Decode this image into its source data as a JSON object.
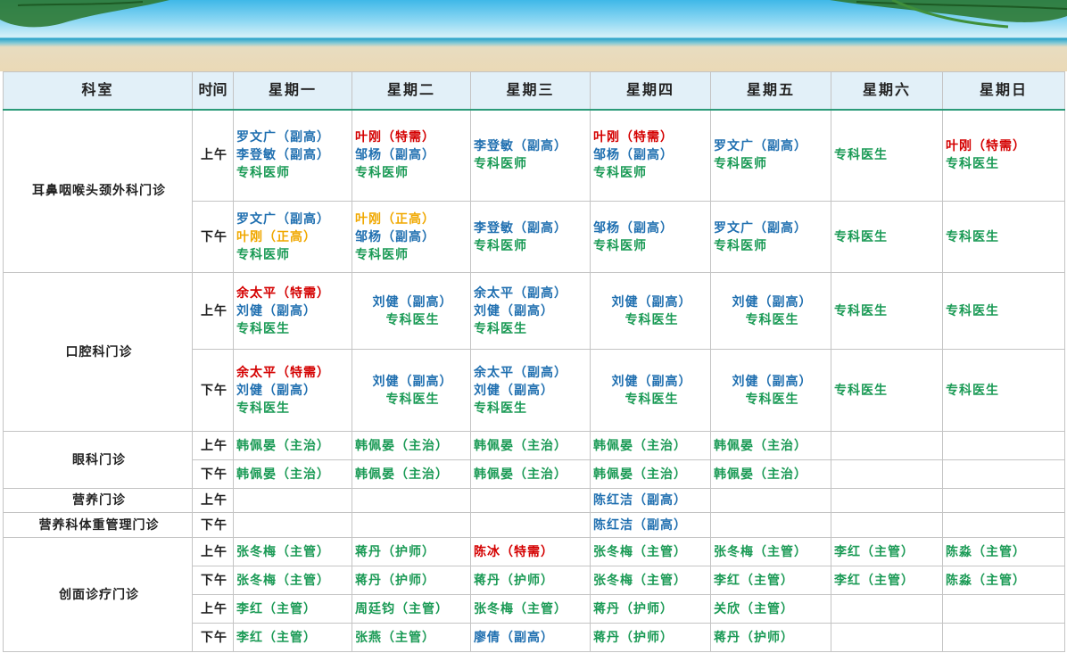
{
  "colors": {
    "blue": "#1f6fb0",
    "green": "#1a9a55",
    "red": "#d40000",
    "orange": "#f0a800"
  },
  "headers": [
    "科室",
    "时间",
    "星期一",
    "星期二",
    "星期三",
    "星期四",
    "星期五",
    "星期六",
    "星期日"
  ],
  "departments": {
    "ent": "耳鼻咽喉头颈外科门诊",
    "oral": "口腔科门诊",
    "eye": "眼科门诊",
    "nutrition": "营养门诊",
    "weight": "营养科体重管理门诊",
    "wound": "创面诊疗门诊"
  },
  "slots": {
    "am": "上午",
    "pm": "下午"
  },
  "rows": [
    {
      "slot": "上午",
      "cells": [
        [
          {
            "t": "罗文广（副高）",
            "c": "blue"
          },
          {
            "t": "李登敏（副高）",
            "c": "blue"
          },
          {
            "t": "专科医师",
            "c": "green"
          }
        ],
        [
          {
            "t": "叶刚（特需）",
            "c": "red"
          },
          {
            "t": "邹杨（副高）",
            "c": "blue"
          },
          {
            "t": "专科医师",
            "c": "green"
          }
        ],
        [
          {
            "t": "李登敏（副高）",
            "c": "blue"
          },
          {
            "t": "专科医师",
            "c": "green"
          }
        ],
        [
          {
            "t": "叶刚（特需）",
            "c": "red"
          },
          {
            "t": "邹杨（副高）",
            "c": "blue"
          },
          {
            "t": "专科医师",
            "c": "green"
          }
        ],
        [
          {
            "t": "罗文广（副高）",
            "c": "blue"
          },
          {
            "t": "专科医师",
            "c": "green"
          }
        ],
        [
          {
            "t": "专科医生",
            "c": "green"
          }
        ],
        [
          {
            "t": "叶刚（特需）",
            "c": "red"
          },
          {
            "t": "专科医生",
            "c": "green"
          }
        ]
      ]
    },
    {
      "slot": "下午",
      "cells": [
        [
          {
            "t": "罗文广（副高）",
            "c": "blue"
          },
          {
            "t": "叶刚（正高）",
            "c": "orange"
          },
          {
            "t": "专科医师",
            "c": "green"
          }
        ],
        [
          {
            "t": "叶刚（正高）",
            "c": "orange"
          },
          {
            "t": "邹杨（副高）",
            "c": "blue"
          },
          {
            "t": "专科医师",
            "c": "green"
          }
        ],
        [
          {
            "t": "李登敏（副高）",
            "c": "blue"
          },
          {
            "t": "专科医师",
            "c": "green"
          }
        ],
        [
          {
            "t": "邹杨（副高）",
            "c": "blue"
          },
          {
            "t": "专科医师",
            "c": "green"
          }
        ],
        [
          {
            "t": "罗文广（副高）",
            "c": "blue"
          },
          {
            "t": "专科医师",
            "c": "green"
          }
        ],
        [
          {
            "t": "专科医生",
            "c": "green"
          }
        ],
        [
          {
            "t": "专科医生",
            "c": "green"
          }
        ]
      ]
    },
    {
      "slot": "上午",
      "cells": [
        [
          {
            "t": "余太平（特需）",
            "c": "red"
          },
          {
            "t": "刘健（副高）",
            "c": "blue"
          },
          {
            "t": "专科医生",
            "c": "green"
          }
        ],
        [
          {
            "t": "刘健（副高）",
            "c": "blue"
          },
          {
            "t": "专科医生",
            "c": "green"
          }
        ],
        [
          {
            "t": "余太平（副高）",
            "c": "blue"
          },
          {
            "t": "刘健（副高）",
            "c": "blue"
          },
          {
            "t": "专科医生",
            "c": "green"
          }
        ],
        [
          {
            "t": "刘健（副高）",
            "c": "blue"
          },
          {
            "t": "专科医生",
            "c": "green"
          }
        ],
        [
          {
            "t": "刘健（副高）",
            "c": "blue"
          },
          {
            "t": "专科医生",
            "c": "green"
          }
        ],
        [
          {
            "t": "专科医生",
            "c": "green"
          }
        ],
        [
          {
            "t": "专科医生",
            "c": "green"
          }
        ]
      ]
    },
    {
      "slot": "下午",
      "cells": [
        [
          {
            "t": "余太平（特需）",
            "c": "red"
          },
          {
            "t": "刘健（副高）",
            "c": "blue"
          },
          {
            "t": "专科医生",
            "c": "green"
          }
        ],
        [
          {
            "t": "刘健（副高）",
            "c": "blue"
          },
          {
            "t": "专科医生",
            "c": "green"
          }
        ],
        [
          {
            "t": "余太平（副高）",
            "c": "blue"
          },
          {
            "t": "刘健（副高）",
            "c": "blue"
          },
          {
            "t": "专科医生",
            "c": "green"
          }
        ],
        [
          {
            "t": "刘健（副高）",
            "c": "blue"
          },
          {
            "t": "专科医生",
            "c": "green"
          }
        ],
        [
          {
            "t": "刘健（副高）",
            "c": "blue"
          },
          {
            "t": "专科医生",
            "c": "green"
          }
        ],
        [
          {
            "t": "专科医生",
            "c": "green"
          }
        ],
        [
          {
            "t": "专科医生",
            "c": "green"
          }
        ]
      ]
    },
    {
      "slot": "上午",
      "cells": [
        [
          {
            "t": "韩佩晏（主治）",
            "c": "green"
          }
        ],
        [
          {
            "t": "韩佩晏（主治）",
            "c": "green"
          }
        ],
        [
          {
            "t": "韩佩晏（主治）",
            "c": "green"
          }
        ],
        [
          {
            "t": "韩佩晏（主治）",
            "c": "green"
          }
        ],
        [
          {
            "t": "韩佩晏（主治）",
            "c": "green"
          }
        ],
        [],
        []
      ]
    },
    {
      "slot": "下午",
      "cells": [
        [
          {
            "t": "韩佩晏（主治）",
            "c": "green"
          }
        ],
        [
          {
            "t": "韩佩晏（主治）",
            "c": "green"
          }
        ],
        [
          {
            "t": "韩佩晏（主治）",
            "c": "green"
          }
        ],
        [
          {
            "t": "韩佩晏（主治）",
            "c": "green"
          }
        ],
        [
          {
            "t": "韩佩晏（主治）",
            "c": "green"
          }
        ],
        [],
        []
      ]
    },
    {
      "slot": "上午",
      "cells": [
        [],
        [],
        [],
        [
          {
            "t": "陈红洁（副高）",
            "c": "blue"
          }
        ],
        [],
        [],
        []
      ]
    },
    {
      "slot": "下午",
      "cells": [
        [],
        [],
        [],
        [
          {
            "t": "陈红洁（副高）",
            "c": "blue"
          }
        ],
        [],
        [],
        []
      ]
    },
    {
      "slot": "上午",
      "cells": [
        [
          {
            "t": "张冬梅（主管）",
            "c": "green"
          }
        ],
        [
          {
            "t": "蒋丹（护师）",
            "c": "green"
          }
        ],
        [
          {
            "t": "陈冰（特需）",
            "c": "red"
          }
        ],
        [
          {
            "t": "张冬梅（主管）",
            "c": "green"
          }
        ],
        [
          {
            "t": "张冬梅（主管）",
            "c": "green"
          }
        ],
        [
          {
            "t": "李红（主管）",
            "c": "green"
          }
        ],
        [
          {
            "t": "陈淼（主管）",
            "c": "green"
          }
        ]
      ]
    },
    {
      "slot": "下午",
      "cells": [
        [
          {
            "t": "张冬梅（主管）",
            "c": "green"
          }
        ],
        [
          {
            "t": "蒋丹（护师）",
            "c": "green"
          }
        ],
        [
          {
            "t": "蒋丹（护师）",
            "c": "green"
          }
        ],
        [
          {
            "t": "张冬梅（主管）",
            "c": "green"
          }
        ],
        [
          {
            "t": "李红（主管）",
            "c": "green"
          }
        ],
        [
          {
            "t": "李红（主管）",
            "c": "green"
          }
        ],
        [
          {
            "t": "陈淼（主管）",
            "c": "green"
          }
        ]
      ]
    },
    {
      "slot": "上午",
      "cells": [
        [
          {
            "t": "李红（主管）",
            "c": "green"
          }
        ],
        [
          {
            "t": "周廷钧（主管）",
            "c": "green"
          }
        ],
        [
          {
            "t": "张冬梅（主管）",
            "c": "green"
          }
        ],
        [
          {
            "t": "蒋丹（护师）",
            "c": "green"
          }
        ],
        [
          {
            "t": "关欣（主管）",
            "c": "green"
          }
        ],
        [],
        []
      ]
    },
    {
      "slot": "下午",
      "cells": [
        [
          {
            "t": "李红（主管）",
            "c": "green"
          }
        ],
        [
          {
            "t": "张燕（主管）",
            "c": "green"
          }
        ],
        [
          {
            "t": "廖倩（副高）",
            "c": "blue"
          }
        ],
        [
          {
            "t": "蒋丹（护师）",
            "c": "green"
          }
        ],
        [
          {
            "t": "蒋丹（护师）",
            "c": "green"
          }
        ],
        [],
        []
      ]
    }
  ]
}
